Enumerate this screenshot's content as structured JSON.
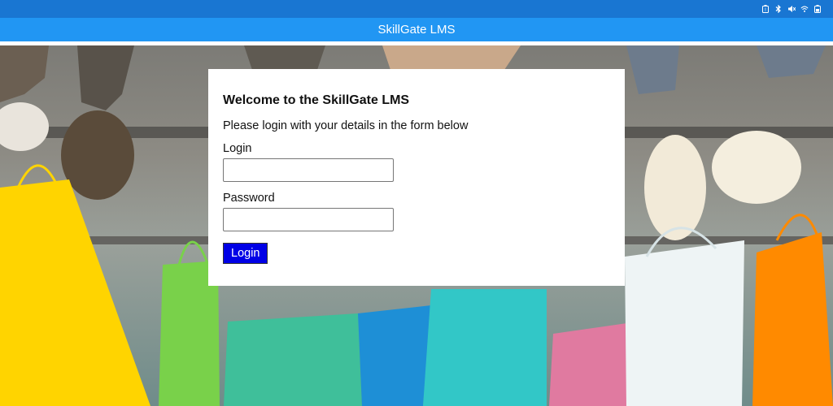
{
  "status_bar": {
    "icons": [
      "battery-alert-icon",
      "bluetooth-icon",
      "mute-icon",
      "wifi-icon",
      "battery-icon"
    ]
  },
  "app_bar": {
    "title": "SkillGate LMS"
  },
  "login_card": {
    "heading": "Welcome to the SkillGate LMS",
    "subtitle": "Please login with your details in the form below",
    "login_label": "Login",
    "login_value": "",
    "password_label": "Password",
    "password_value": "",
    "submit_label": "Login"
  },
  "colors": {
    "status_bar": "#1976d2",
    "app_bar": "#2196f3",
    "submit_button": "#0000e6"
  }
}
